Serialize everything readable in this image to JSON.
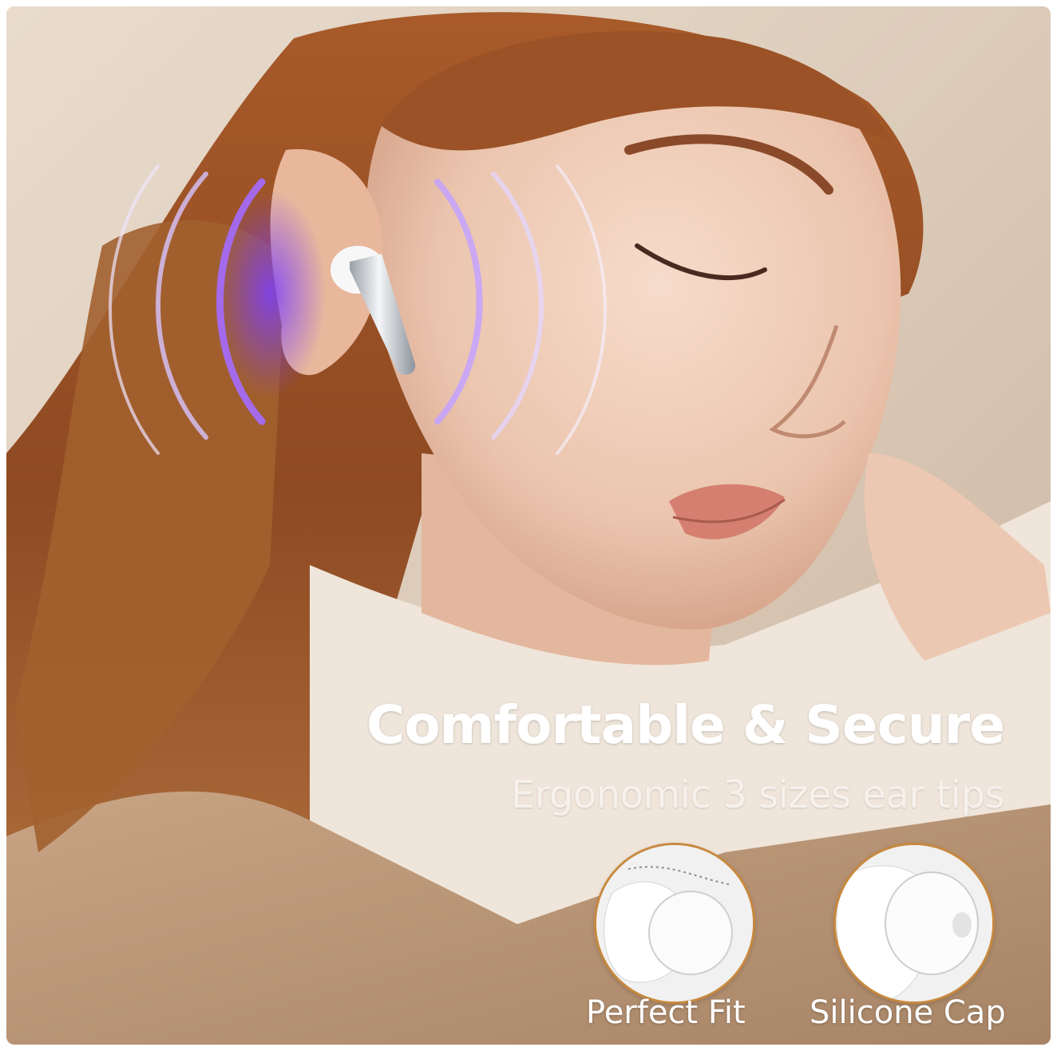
{
  "headline": "Comfortable & Secure",
  "subline": "Ergonomic 3 sizes ear tips",
  "features": [
    {
      "label": "Perfect Fit"
    },
    {
      "label": "Silicone Cap"
    }
  ],
  "colors": {
    "accent_ring": "#c8893e",
    "sound_wave": "#9b6cff",
    "text": "#ffffff"
  }
}
